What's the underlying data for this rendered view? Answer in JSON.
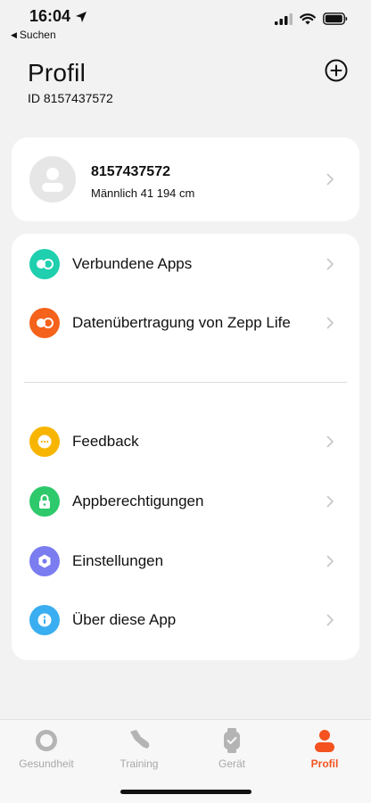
{
  "status_bar": {
    "time": "16:04",
    "back_app": "Suchen"
  },
  "header": {
    "title": "Profil",
    "user_id": "ID 8157437572"
  },
  "profile": {
    "name": "8157437572",
    "details": "Männlich 41 194 cm"
  },
  "menu": {
    "items": [
      {
        "label": "Verbundene Apps",
        "icon": "connected-apps-icon",
        "color": "#1fcfae"
      },
      {
        "label": "Datenübertragung von Zepp Life",
        "icon": "data-transfer-icon",
        "color": "#f5621b"
      },
      {
        "label": "Feedback",
        "icon": "feedback-icon",
        "color": "#f7b500"
      },
      {
        "label": "Appberechtigungen",
        "icon": "lock-icon",
        "color": "#2dc96a"
      },
      {
        "label": "Einstellungen",
        "icon": "settings-icon",
        "color": "#7a7cf0"
      },
      {
        "label": "Über diese App",
        "icon": "info-icon",
        "color": "#39aef0"
      }
    ]
  },
  "tabs": [
    {
      "label": "Gesundheit",
      "icon": "health-icon",
      "active": false
    },
    {
      "label": "Training",
      "icon": "shoe-icon",
      "active": false
    },
    {
      "label": "Gerät",
      "icon": "watch-icon",
      "active": false
    },
    {
      "label": "Profil",
      "icon": "person-icon",
      "active": true
    }
  ],
  "colors": {
    "accent": "#f4531f",
    "inactive": "#a8a8a8",
    "background": "#f2f2f2"
  }
}
